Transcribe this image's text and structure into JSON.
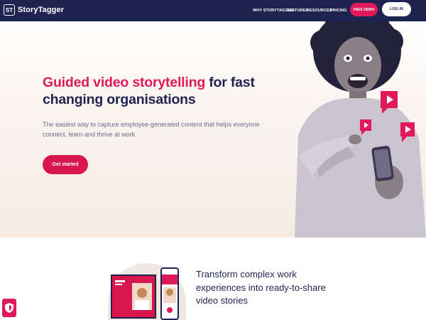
{
  "brand": {
    "mark": "ST",
    "name": "StoryTagger"
  },
  "nav": {
    "items": [
      "WHY STORYTAGGER",
      "FEATURES",
      "RESOURCES",
      "PRICING"
    ],
    "demo_label": "FREE DEMO",
    "login_label": "LOG IN"
  },
  "hero": {
    "title_accent": "Guided video storytelling",
    "title_rest": " for fast changing organisations",
    "subtitle": "The easiest way to capture employee-generated content that helps everyone connect, learn and thrive at work",
    "cta_label": "Get started"
  },
  "lower": {
    "heading": "Transform complex work experiences into ready-to-share video stories"
  },
  "colors": {
    "navy": "#1f2350",
    "accent": "#e0195a",
    "hero_bg": "#f6ebe3"
  }
}
